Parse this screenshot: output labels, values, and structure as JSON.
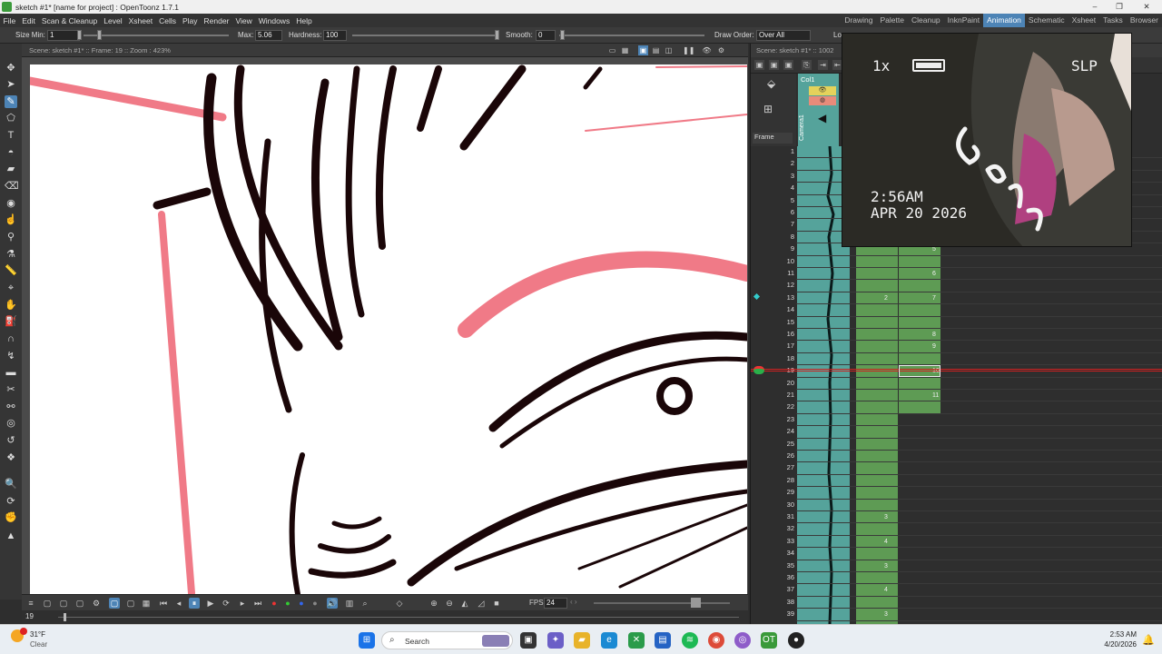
{
  "titlebar": {
    "title": "sketch #1* [name for project] : OpenToonz 1.7.1",
    "minimize": "–",
    "maximize": "❐",
    "close": "✕"
  },
  "menu": [
    "File",
    "Edit",
    "Scan & Cleanup",
    "Level",
    "Xsheet",
    "Cells",
    "Play",
    "Render",
    "View",
    "Windows",
    "Help"
  ],
  "rooms": [
    {
      "label": "Drawing",
      "active": false
    },
    {
      "label": "Palette",
      "active": false
    },
    {
      "label": "Cleanup",
      "active": false
    },
    {
      "label": "InknPaint",
      "active": false
    },
    {
      "label": "Animation",
      "active": true
    },
    {
      "label": "Schematic",
      "active": false
    },
    {
      "label": "Xsheet",
      "active": false
    },
    {
      "label": "Tasks",
      "active": false
    },
    {
      "label": "Browser",
      "active": false
    }
  ],
  "tool_options": {
    "size_min_label": "Size Min:",
    "size_min_value": "1",
    "max_label": "Max:",
    "max_value": "5.06",
    "hardness_label": "Hardness:",
    "hardness_value": "100",
    "smooth_label": "Smooth:",
    "smooth_value": "0",
    "draw_order_label": "Draw Order:",
    "draw_order_value": "Over All",
    "lock_label": "Lo"
  },
  "viewer": {
    "header": "Scene: sketch #1*  ::  Frame: 19  ::  Zoom : 423%",
    "fps_label": "FPS",
    "fps_value": "24",
    "frame_field": "19"
  },
  "xsheet": {
    "header": "Scene: sketch #1*  ::  1002",
    "column_name": "Col1",
    "camera_label": "Camera1",
    "frame_dropdown": "Frame",
    "current_frame": 19,
    "rows": [
      "1",
      "2",
      "3",
      "4",
      "5",
      "6",
      "7",
      "8",
      "9",
      "10",
      "11",
      "12",
      "13",
      "14",
      "15",
      "16",
      "17",
      "18",
      "19",
      "20",
      "21",
      "22",
      "23",
      "24",
      "25",
      "26",
      "27",
      "28",
      "29",
      "30",
      "31",
      "32",
      "33",
      "34",
      "35",
      "36",
      "37",
      "38",
      "39"
    ],
    "col2_cells": [
      {
        "row": 13,
        "text": "2"
      },
      {
        "row": 31,
        "text": "3"
      },
      {
        "row": 33,
        "text": "4"
      },
      {
        "row": 35,
        "text": "3"
      },
      {
        "row": 37,
        "text": "4"
      },
      {
        "row": 39,
        "text": "3"
      }
    ],
    "col3_cells": [
      {
        "row": 9,
        "text": "5"
      },
      {
        "row": 11,
        "text": "6"
      },
      {
        "row": 13,
        "text": "7"
      },
      {
        "row": 16,
        "text": "8"
      },
      {
        "row": 17,
        "text": "9"
      },
      {
        "row": 19,
        "text": "10"
      },
      {
        "row": 21,
        "text": "11"
      }
    ]
  },
  "overlay": {
    "speed": "1x",
    "mode": "SLP",
    "time": "2:56AM",
    "date": "APR 20 2026"
  },
  "taskbar": {
    "weather_temp": "31°F",
    "weather_desc": "Clear",
    "search_placeholder": "Search",
    "clock_time": "2:53 AM",
    "clock_date": "4/20/2026"
  },
  "colors": {
    "accent": "#4d84b6",
    "sound_column": "#55a39b",
    "level_column": "#5e9b54",
    "current_frame_line": "#d02020",
    "sketch_pink": "#f07a87"
  }
}
